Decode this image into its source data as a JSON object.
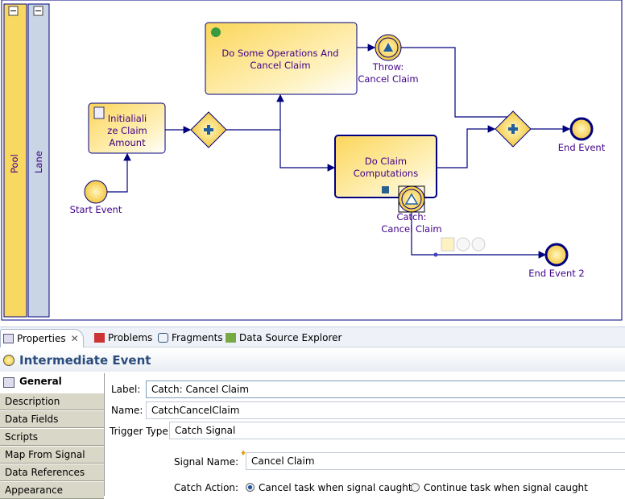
{
  "diagram": {
    "pool": "Pool",
    "lane": "Lane",
    "task_ops": [
      "Do Some Operations And",
      "Cancel Claim"
    ],
    "task_init": [
      "Initialiali",
      "ze Claim",
      "Amount"
    ],
    "task_compute": [
      "Do Claim",
      "Computations"
    ],
    "throw_event": [
      "Throw:",
      "Cancel Claim"
    ],
    "catch_event": [
      "Catch:",
      "Cancel Claim"
    ],
    "start_event": "Start Event",
    "end_event": "End Event",
    "end_event_2": "End Event 2"
  },
  "tabs": [
    {
      "label": "Properties",
      "icon": "properties-icon"
    },
    {
      "label": "Problems",
      "icon": "problems-icon"
    },
    {
      "label": "Fragments",
      "icon": "fragments-icon"
    },
    {
      "label": "Data Source Explorer",
      "icon": "data-source-icon"
    }
  ],
  "header": {
    "title": "Intermediate Event"
  },
  "side_tabs": [
    "General",
    "Description",
    "Data Fields",
    "Scripts",
    "Map From Signal",
    "Data References",
    "Appearance"
  ],
  "form": {
    "label_label": "Label:",
    "label_value": "Catch: Cancel Claim",
    "name_label": "Name:",
    "name_value": "CatchCancelClaim",
    "trigger_label": "Trigger Type:",
    "trigger_value": "Catch Signal",
    "signal_label": "Signal Name:",
    "signal_value": "Cancel Claim",
    "action_label": "Catch Action:",
    "action_options": [
      {
        "label": "Cancel task when signal caught",
        "selected": true
      },
      {
        "label": "Continue task when signal caught",
        "selected": false
      }
    ]
  },
  "colors": {
    "flow": "#000080",
    "task_fill": "#fde27a",
    "label_text": "#40008a",
    "header_text": "#2a4b7c"
  }
}
